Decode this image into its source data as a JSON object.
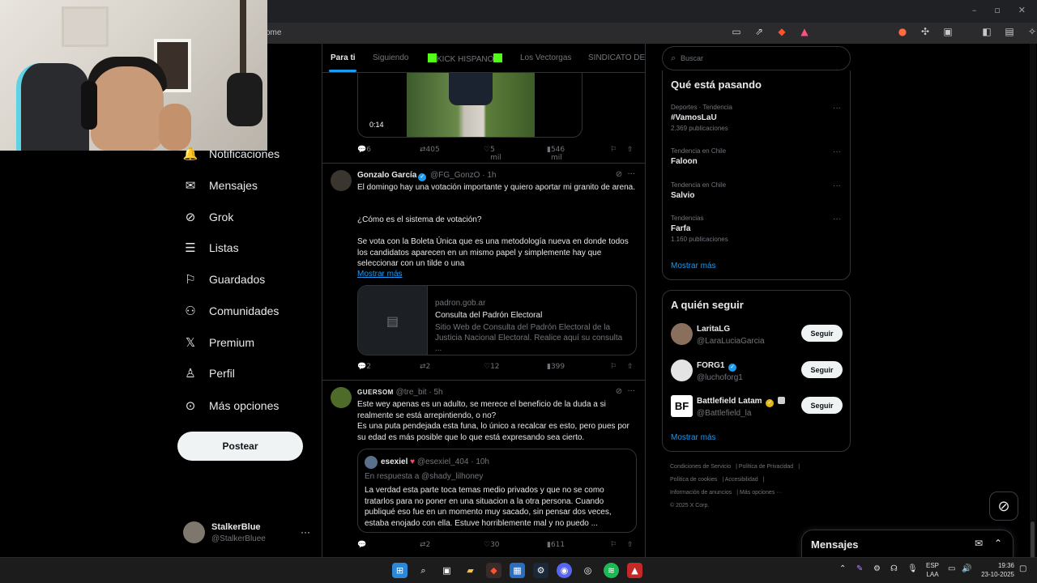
{
  "browser": {
    "url": "ome",
    "window_controls": [
      "–",
      "▫",
      "✕"
    ]
  },
  "nav": {
    "items": [
      {
        "label": "Notificaciones",
        "icon": "bell-icon"
      },
      {
        "label": "Mensajes",
        "icon": "mail-icon"
      },
      {
        "label": "Grok",
        "icon": "grok-icon"
      },
      {
        "label": "Listas",
        "icon": "list-icon"
      },
      {
        "label": "Guardados",
        "icon": "bookmark-icon"
      },
      {
        "label": "Comunidades",
        "icon": "communities-icon"
      },
      {
        "label": "Premium",
        "icon": "x-logo-icon"
      },
      {
        "label": "Perfil",
        "icon": "person-icon"
      },
      {
        "label": "Más opciones",
        "icon": "more-circle-icon"
      }
    ],
    "post_button": "Postear"
  },
  "account": {
    "name": "StalkerBlue",
    "handle": "@StalkerBluee",
    "more": "···"
  },
  "tabs": [
    "Para ti",
    "Siguiendo",
    "KICK HISPANO",
    "Los Vectorgas",
    "SINDICATO DE C"
  ],
  "tweets": [
    {
      "video_time": "0:14",
      "actions": {
        "replies": "6",
        "reposts": "405",
        "likes": "5 mil",
        "views": "546 mil"
      }
    },
    {
      "name": "Gonzalo García",
      "handle": "@FG_GonzO",
      "time": "1h",
      "text": [
        "El domingo hay una votación importante y quiero aportar mi granito de arena.",
        "¿Cómo es el sistema de votación?",
        "Se vota con la Boleta Única que es una metodología nueva en donde todos los candidatos aparecen en un mismo papel y simplemente hay que seleccionar con un tilde o una"
      ],
      "show_more": "Mostrar más",
      "card": {
        "domain": "padron.gob.ar",
        "title": "Consulta del Padrón Electoral",
        "description": "Sitio Web de Consulta del Padrón Electoral de la Justicia Nacional Electoral. Realice aquí su consulta ..."
      },
      "actions": {
        "replies": "2",
        "reposts": "2",
        "likes": "12",
        "views": "399"
      }
    },
    {
      "name": "GUERSOM",
      "handle": "@tre_bit",
      "time": "5h",
      "text": [
        "Este wey apenas es un adulto, se merece el beneficio de la duda a si realmente se está arrepintiendo, o no?",
        "Es una puta pendejada esta funa, lo único a recalcar es esto, pero pues por su edad es más posible que lo que está expresando sea cierto."
      ],
      "quote": {
        "name": "esexiel",
        "handle": "@esexiel_404",
        "time": "10h",
        "reply_to": "En respuesta a @shady_lilhoney",
        "text": "La verdad esta parte toca temas medio privados y que no se como tratarlos para no poner en una situacion a la otra persona. Cuando publiqué eso fue en un momento muy sacado, sin pensar dos veces, estaba enojado con ella. Estuve horriblemente mal y no puedo ..."
      },
      "actions": {
        "replies": "",
        "reposts": "2",
        "likes": "30",
        "views": "611"
      }
    }
  ],
  "search": {
    "placeholder": "Buscar"
  },
  "trending": {
    "title": "Qué está pasando",
    "items": [
      {
        "category": "Deportes · Tendencia",
        "name": "#VamosLaU",
        "count": "2.369 publicaciones"
      },
      {
        "category": "Tendencia en Chile",
        "name": "Faloon",
        "count": ""
      },
      {
        "category": "Tendencia en Chile",
        "name": "Salvio",
        "count": ""
      },
      {
        "category": "Tendencias",
        "name": "Farfa",
        "count": "1.160 publicaciones"
      }
    ],
    "show_more": "Mostrar más"
  },
  "who_to_follow": {
    "title": "A quién seguir",
    "items": [
      {
        "name": "LaritaLG",
        "handle": "@LaraLuciaGarcia",
        "button": "Seguir"
      },
      {
        "name": "FORG1",
        "handle": "@luchoforg1",
        "button": "Seguir"
      },
      {
        "name": "Battlefield Latam",
        "handle": "@Battlefield_la",
        "button": "Seguir"
      }
    ],
    "show_more": "Mostrar más"
  },
  "footer": {
    "links": [
      "Condiciones de Servicio",
      "Política de Privacidad",
      "Política de cookies",
      "Accesibilidad",
      "Información de anuncios",
      "Más opciones ···"
    ],
    "copyright": "© 2025 X Corp."
  },
  "messages_drawer": {
    "title": "Mensajes"
  },
  "taskbar": {
    "lang_top": "ESP",
    "lang_bottom": "LAA",
    "time": "19:36",
    "date": "23-10-2025"
  },
  "colors": {
    "accent": "#1d9bf0",
    "background": "#000000",
    "border": "#2f3336",
    "muted": "#71767b"
  }
}
